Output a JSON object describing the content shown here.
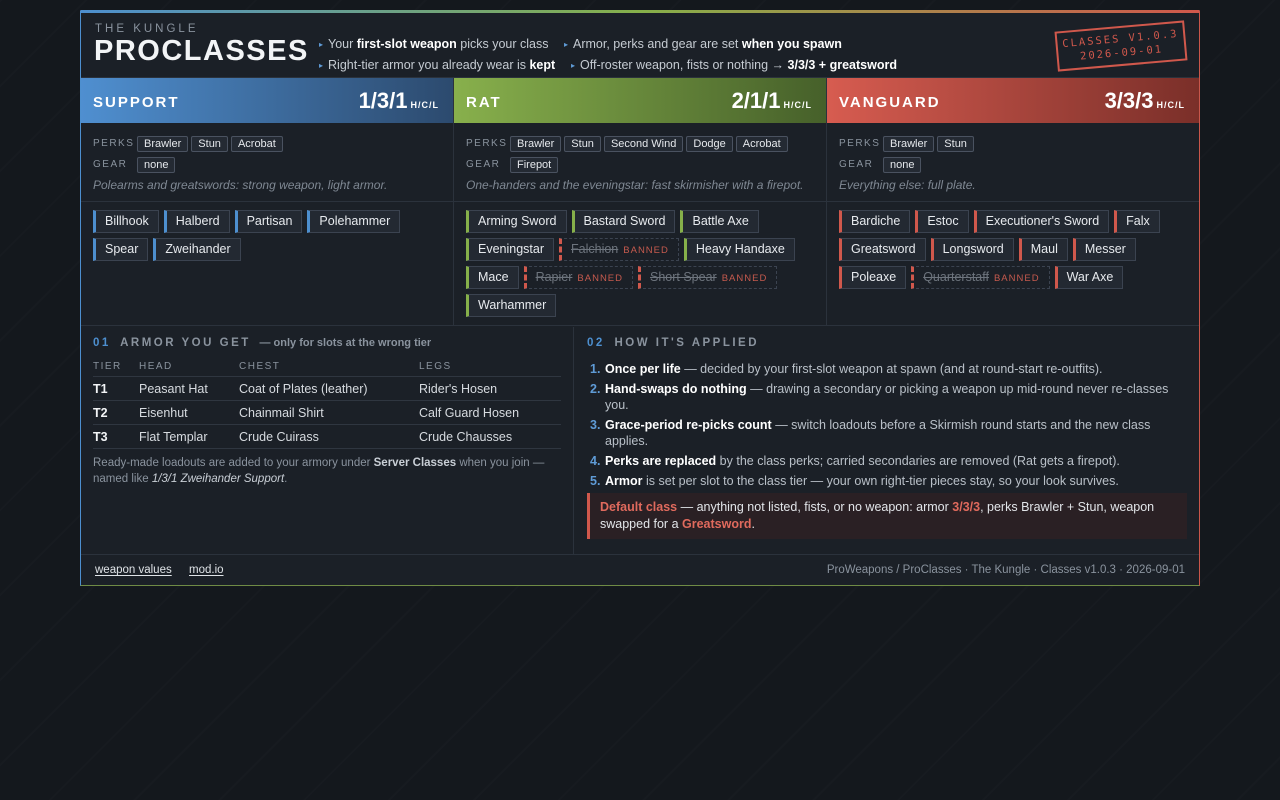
{
  "header": {
    "org": "THE KUNGLE",
    "title": "PROCLASSES",
    "highlights": [
      {
        "pre": "Your ",
        "bold": "first-slot weapon",
        "post": " picks your class"
      },
      {
        "pre": "Armor, perks and gear are set ",
        "bold": "when you spawn",
        "post": ""
      },
      {
        "pre": "Right-tier armor you already wear is ",
        "bold": "kept",
        "post": ""
      },
      {
        "pre": "Off-roster weapon, fists or nothing → ",
        "bold": "3/3/3 + greatsword",
        "post": ""
      }
    ],
    "stamp_line1": "CLASSES V1.0.3",
    "stamp_line2": "2026-09-01"
  },
  "classes": [
    {
      "name": "SUPPORT",
      "value": "1/3/1",
      "unit": "H/C/L",
      "color": "#4d8fcf",
      "perks_label": "PERKS",
      "perks": [
        "Brawler",
        "Stun",
        "Acrobat"
      ],
      "gear_label": "GEAR",
      "gear": [
        "none"
      ],
      "description": "Polearms and greatswords: strong weapon, light armor.",
      "weapons": [
        {
          "name": "Billhook"
        },
        {
          "name": "Halberd"
        },
        {
          "name": "Partisan"
        },
        {
          "name": "Polehammer"
        },
        {
          "name": "Spear"
        },
        {
          "name": "Zweihander"
        }
      ]
    },
    {
      "name": "RAT",
      "value": "2/1/1",
      "unit": "H/C/L",
      "color": "#86b04a",
      "perks_label": "PERKS",
      "perks": [
        "Brawler",
        "Stun",
        "Second Wind",
        "Dodge",
        "Acrobat"
      ],
      "gear_label": "GEAR",
      "gear": [
        "Firepot"
      ],
      "description": "One-handers and the eveningstar: fast skirmisher with a firepot.",
      "weapons": [
        {
          "name": "Arming Sword"
        },
        {
          "name": "Bastard Sword"
        },
        {
          "name": "Battle Axe"
        },
        {
          "name": "Eveningstar"
        },
        {
          "name": "Falchion",
          "banned": "BANNED"
        },
        {
          "name": "Heavy Handaxe"
        },
        {
          "name": "Mace"
        },
        {
          "name": "Rapier",
          "banned": "BANNED"
        },
        {
          "name": "Short Spear",
          "banned": "BANNED"
        },
        {
          "name": "Warhammer"
        }
      ]
    },
    {
      "name": "VANGUARD",
      "value": "3/3/3",
      "unit": "H/C/L",
      "color": "#d0584c",
      "perks_label": "PERKS",
      "perks": [
        "Brawler",
        "Stun"
      ],
      "gear_label": "GEAR",
      "gear": [
        "none"
      ],
      "description": "Everything else: full plate.",
      "weapons": [
        {
          "name": "Bardiche"
        },
        {
          "name": "Estoc"
        },
        {
          "name": "Executioner's Sword"
        },
        {
          "name": "Falx"
        },
        {
          "name": "Greatsword"
        },
        {
          "name": "Longsword"
        },
        {
          "name": "Maul"
        },
        {
          "name": "Messer"
        },
        {
          "name": "Poleaxe"
        },
        {
          "name": "Quarterstaff",
          "banned": "BANNED"
        },
        {
          "name": "War Axe"
        }
      ]
    }
  ],
  "armor": {
    "num": "01",
    "title": "ARMOR YOU GET",
    "subtitle": "— only for slots at the wrong tier",
    "headers": [
      "TIER",
      "HEAD",
      "CHEST",
      "LEGS"
    ],
    "rows": [
      [
        "T1",
        "Peasant Hat",
        "Coat of Plates (leather)",
        "Rider's Hosen"
      ],
      [
        "T2",
        "Eisenhut",
        "Chainmail Shirt",
        "Calf Guard Hosen"
      ],
      [
        "T3",
        "Flat Templar",
        "Crude Cuirass",
        "Crude Chausses"
      ]
    ],
    "note_pre": "Ready-made loadouts are added to your armory under ",
    "note_bold": "Server Classes",
    "note_mid": " when you join — named like ",
    "note_italic": "1/3/1 Zweihander Support",
    "note_post": "."
  },
  "applied": {
    "num": "02",
    "title": "HOW IT'S APPLIED",
    "items": [
      {
        "n": "1.",
        "bold": "Once per life",
        "text": " — decided by your first-slot weapon at spawn (and at round-start re-outfits)."
      },
      {
        "n": "2.",
        "bold": "Hand-swaps do nothing",
        "text": " — drawing a secondary or picking a weapon up mid-round never re-classes you."
      },
      {
        "n": "3.",
        "bold": "Grace-period re-picks count",
        "text": " — switch loadouts before a Skirmish round starts and the new class applies."
      },
      {
        "n": "4.",
        "bold": "Perks are replaced",
        "text": " by the class perks; carried secondaries are removed (Rat gets a firepot)."
      },
      {
        "n": "5.",
        "bold": "Armor",
        "text": " is set per slot to the class tier — your own right-tier pieces stay, so your look survives."
      }
    ],
    "default_label": "Default class",
    "default_pre": " — anything not listed, fists, or no weapon: armor ",
    "default_armor": "3/3/3",
    "default_mid": ", perks Brawler + Stun, weapon swapped for a ",
    "default_weapon": "Greatsword",
    "default_post": "."
  },
  "footer": {
    "links": [
      "weapon values",
      "mod.io"
    ],
    "right": "ProWeapons / ProClasses · The Kungle · Classes v1.0.3 · 2026-09-01"
  }
}
